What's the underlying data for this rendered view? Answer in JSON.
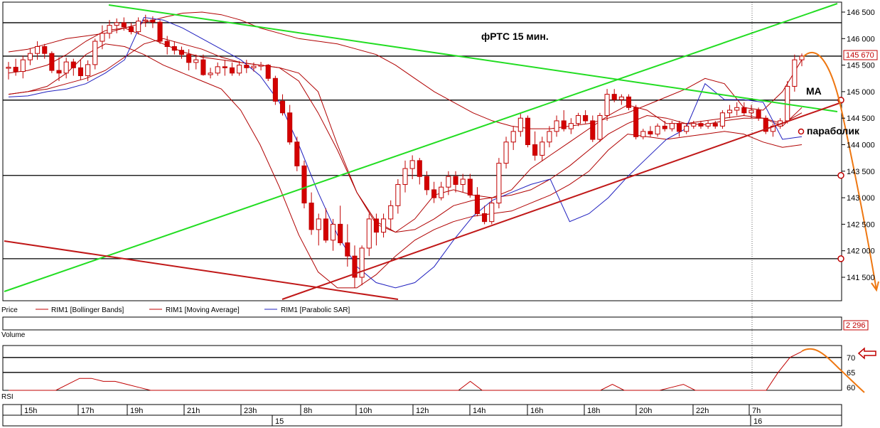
{
  "chart_data": {
    "type": "candlestick",
    "annotation_title": "фРТС  15 мин.",
    "price_axis": {
      "ticks": [
        "146 500",
        "146 000",
        "145 500",
        "145 000",
        "144 500",
        "144 000",
        "143 500",
        "143 000",
        "142 500",
        "142 000",
        "141 500"
      ],
      "ylim": [
        141250,
        146650
      ],
      "last_price": "145 670"
    },
    "legend": {
      "price_label": "Price",
      "items": [
        "RIM1 [Bollinger Bands]",
        "RIM1 [Moving Average]",
        "RIM1 [Parabolic SAR]"
      ]
    },
    "volume_panel": {
      "label": "Volume",
      "value": "2 296"
    },
    "rsi_panel": {
      "label": "RSI",
      "ticks": [
        "70",
        "65",
        "60"
      ],
      "ylim": [
        59,
        74
      ],
      "levels": [
        70,
        65
      ]
    },
    "time_axis": {
      "hour_ticks": [
        "15h",
        "17h",
        "19h",
        "21h",
        "23h",
        "8h",
        "10h",
        "12h",
        "14h",
        "16h",
        "18h",
        "20h",
        "22h",
        "7h"
      ],
      "day_labels": [
        "15",
        "16"
      ]
    },
    "annotations": [
      "MA",
      "параболик"
    ],
    "horizontal_levels": [
      146300,
      145670,
      144840,
      143420,
      141850
    ],
    "candles": [
      [
        145440,
        145560,
        145230,
        145460
      ],
      [
        145460,
        145620,
        145300,
        145380
      ],
      [
        145380,
        145680,
        145250,
        145600
      ],
      [
        145600,
        145820,
        145500,
        145720
      ],
      [
        145720,
        145950,
        145600,
        145850
      ],
      [
        145850,
        145900,
        145620,
        145720
      ],
      [
        145720,
        145760,
        145350,
        145400
      ],
      [
        145400,
        145650,
        145200,
        145350
      ],
      [
        145350,
        145640,
        145250,
        145560
      ],
      [
        145560,
        145620,
        145300,
        145450
      ],
      [
        145450,
        145600,
        145220,
        145300
      ],
      [
        145300,
        145590,
        145200,
        145510
      ],
      [
        145510,
        146000,
        145420,
        145950
      ],
      [
        145950,
        146250,
        145800,
        146100
      ],
      [
        146100,
        146350,
        146000,
        146250
      ],
      [
        146250,
        146380,
        146100,
        146300
      ],
      [
        146300,
        146400,
        146150,
        146220
      ],
      [
        146220,
        146300,
        146080,
        146130
      ],
      [
        146130,
        146400,
        146080,
        146330
      ],
      [
        146330,
        146450,
        146220,
        146350
      ],
      [
        146350,
        146420,
        146200,
        146310
      ],
      [
        146310,
        146350,
        145900,
        145950
      ],
      [
        145950,
        146050,
        145700,
        145850
      ],
      [
        145850,
        145950,
        145700,
        145780
      ],
      [
        145780,
        145850,
        145620,
        145700
      ],
      [
        145700,
        145800,
        145400,
        145550
      ],
      [
        145550,
        145700,
        145420,
        145600
      ],
      [
        145600,
        145700,
        145300,
        145320
      ],
      [
        145320,
        145450,
        145250,
        145350
      ],
      [
        145350,
        145550,
        145300,
        145470
      ],
      [
        145470,
        145600,
        145300,
        145450
      ],
      [
        145450,
        145550,
        145300,
        145350
      ],
      [
        145350,
        145580,
        145300,
        145500
      ],
      [
        145500,
        145600,
        145350,
        145450
      ],
      [
        145450,
        145550,
        145380,
        145480
      ],
      [
        145480,
        145560,
        145400,
        145500
      ],
      [
        145500,
        145520,
        145200,
        145250
      ],
      [
        145250,
        145300,
        144750,
        144820
      ],
      [
        144820,
        144950,
        144550,
        144600
      ],
      [
        144600,
        144750,
        144000,
        144050
      ],
      [
        144050,
        144150,
        143500,
        143600
      ],
      [
        143600,
        143700,
        142800,
        142900
      ],
      [
        142900,
        143100,
        142300,
        142400
      ],
      [
        142400,
        142700,
        142100,
        142600
      ],
      [
        142600,
        142800,
        142150,
        142200
      ],
      [
        142200,
        142600,
        142000,
        142500
      ],
      [
        142500,
        142850,
        142100,
        142150
      ],
      [
        142150,
        142500,
        141700,
        141900
      ],
      [
        141900,
        142100,
        141300,
        141500
      ],
      [
        141500,
        142100,
        141350,
        142050
      ],
      [
        142050,
        142700,
        141900,
        142600
      ],
      [
        142600,
        142700,
        142100,
        142350
      ],
      [
        142350,
        142700,
        142250,
        142600
      ],
      [
        142600,
        142950,
        142400,
        142850
      ],
      [
        142850,
        143350,
        142700,
        143250
      ],
      [
        143250,
        143700,
        143100,
        143550
      ],
      [
        143550,
        143800,
        143350,
        143700
      ],
      [
        143700,
        143750,
        143250,
        143400
      ],
      [
        143400,
        143500,
        143050,
        143150
      ],
      [
        143150,
        143300,
        142900,
        143000
      ],
      [
        143000,
        143300,
        142950,
        143200
      ],
      [
        143200,
        143500,
        143050,
        143400
      ],
      [
        143400,
        143500,
        143100,
        143250
      ],
      [
        143250,
        143450,
        143100,
        143350
      ],
      [
        143350,
        143450,
        143000,
        143050
      ],
      [
        143050,
        143200,
        142650,
        142700
      ],
      [
        142700,
        142850,
        142500,
        142550
      ],
      [
        142550,
        143000,
        142500,
        142900
      ],
      [
        142900,
        143750,
        142800,
        143650
      ],
      [
        143650,
        144150,
        143550,
        144050
      ],
      [
        144050,
        144350,
        143900,
        144250
      ],
      [
        144250,
        144600,
        144150,
        144500
      ],
      [
        144500,
        144550,
        143950,
        144000
      ],
      [
        144000,
        144250,
        143700,
        143800
      ],
      [
        143800,
        144150,
        143700,
        144050
      ],
      [
        144050,
        144350,
        143950,
        144250
      ],
      [
        144250,
        144550,
        144150,
        144450
      ],
      [
        144450,
        144650,
        144250,
        144300
      ],
      [
        144300,
        144500,
        144200,
        144400
      ],
      [
        144400,
        144600,
        144350,
        144550
      ],
      [
        144550,
        144650,
        144400,
        144450
      ],
      [
        144450,
        144550,
        144050,
        144100
      ],
      [
        144100,
        144600,
        144050,
        144550
      ],
      [
        144550,
        145050,
        144450,
        144950
      ],
      [
        144950,
        145050,
        144800,
        144850
      ],
      [
        144850,
        144950,
        144750,
        144900
      ],
      [
        144900,
        144950,
        144650,
        144700
      ],
      [
        144700,
        144750,
        144100,
        144150
      ],
      [
        144150,
        144300,
        144100,
        144250
      ],
      [
        144250,
        144350,
        144150,
        144200
      ],
      [
        144200,
        144400,
        144150,
        144350
      ],
      [
        144350,
        144450,
        144250,
        144300
      ],
      [
        144300,
        144450,
        144250,
        144400
      ],
      [
        144400,
        144450,
        144150,
        144250
      ],
      [
        144250,
        144400,
        144200,
        144350
      ],
      [
        144350,
        144450,
        144300,
        144400
      ],
      [
        144400,
        144450,
        144300,
        144350
      ],
      [
        144350,
        144450,
        144300,
        144400
      ],
      [
        144400,
        144450,
        144300,
        144350
      ],
      [
        144350,
        144650,
        144300,
        144600
      ],
      [
        144600,
        144750,
        144500,
        144650
      ],
      [
        144650,
        144800,
        144550,
        144700
      ],
      [
        144700,
        144800,
        144550,
        144600
      ],
      [
        144600,
        144750,
        144500,
        144650
      ],
      [
        144650,
        144700,
        144450,
        144500
      ],
      [
        144500,
        144550,
        144200,
        144250
      ],
      [
        144250,
        144400,
        144150,
        144350
      ],
      [
        144350,
        144500,
        144300,
        144450
      ],
      [
        144450,
        145200,
        144400,
        145100
      ],
      [
        145100,
        145700,
        145000,
        145600
      ],
      [
        145600,
        145720,
        145480,
        145670
      ]
    ],
    "bollinger_upper": [
      145750,
      145800,
      145900,
      146000,
      146050,
      146100,
      146200,
      146300,
      146400,
      146480,
      146500,
      146450,
      146350,
      146200,
      146100,
      146000,
      145950,
      145900,
      145800,
      145700,
      145500,
      145250,
      145000,
      144800,
      144600,
      144450,
      144350,
      144300,
      144300,
      144350,
      144400,
      144500,
      144600,
      144750,
      144900,
      145050,
      145250,
      145150,
      144700,
      144650,
      145000,
      145600
    ],
    "bollinger_middle": [
      145350,
      145400,
      145500,
      145700,
      145950,
      146150,
      146200,
      146050,
      145900,
      145750,
      145650,
      145600,
      145550,
      145500,
      145450,
      145200,
      144600,
      143900,
      143100,
      142500,
      142350,
      142600,
      143050,
      143150,
      143050,
      143000,
      143150,
      143550,
      143800,
      144050,
      144300,
      144550,
      144750,
      144650,
      144400,
      144400,
      144450,
      144500,
      144550,
      144500,
      144350,
      144700
    ],
    "bollinger_lower": [
      144950,
      145000,
      145100,
      145350,
      145700,
      145900,
      145850,
      145700,
      145500,
      145350,
      145200,
      145050,
      144650,
      144000,
      143200,
      142300,
      141600,
      141300,
      141300,
      141550,
      141900,
      142200,
      142400,
      142550,
      142650,
      142700,
      142750,
      142900,
      143050,
      143250,
      143500,
      143900,
      144200,
      144150,
      144100,
      144150,
      144200,
      144250,
      144200,
      144050,
      143950,
      144000
    ],
    "moving_average": [
      144950,
      145000,
      145050,
      145150,
      145250,
      145400,
      145650,
      145900,
      146000,
      145900,
      145800,
      145650,
      145550,
      145500,
      145450,
      145350,
      145000,
      144000,
      143100,
      142550,
      142350,
      142400,
      142600,
      142850,
      142950,
      143000,
      143050,
      143150,
      143350,
      143600,
      143900,
      144200,
      144400,
      144550,
      144500,
      144400,
      144380,
      144450,
      144500,
      144500,
      144400,
      144600
    ],
    "parabolic_sar": [
      144900,
      144920,
      145000,
      145050,
      145150,
      145350,
      145600,
      146400,
      146350,
      146200,
      146000,
      145800,
      145600,
      145300,
      144800,
      144000,
      143100,
      142300,
      141700,
      141400,
      141300,
      141400,
      141700,
      142200,
      142650,
      142950,
      143100,
      143250,
      143350,
      142550,
      142700,
      143000,
      143400,
      143750,
      144100,
      144300,
      145150,
      144850,
      144850,
      144800,
      144100,
      144150
    ],
    "rsi": [
      59,
      59,
      59,
      59,
      59,
      61,
      63,
      63,
      62,
      62,
      61,
      60,
      59,
      59,
      59,
      59,
      59,
      59,
      59,
      59,
      59,
      59,
      59,
      59,
      59,
      59,
      59,
      59,
      59,
      59,
      59,
      59,
      59,
      59,
      59,
      59,
      59,
      59,
      59,
      62,
      59,
      59,
      59,
      59,
      59,
      59,
      59,
      59,
      59,
      59,
      59,
      61,
      59,
      59,
      59,
      59,
      60,
      61,
      59,
      59,
      59,
      59,
      59,
      59,
      59,
      65,
      70,
      72
    ]
  }
}
